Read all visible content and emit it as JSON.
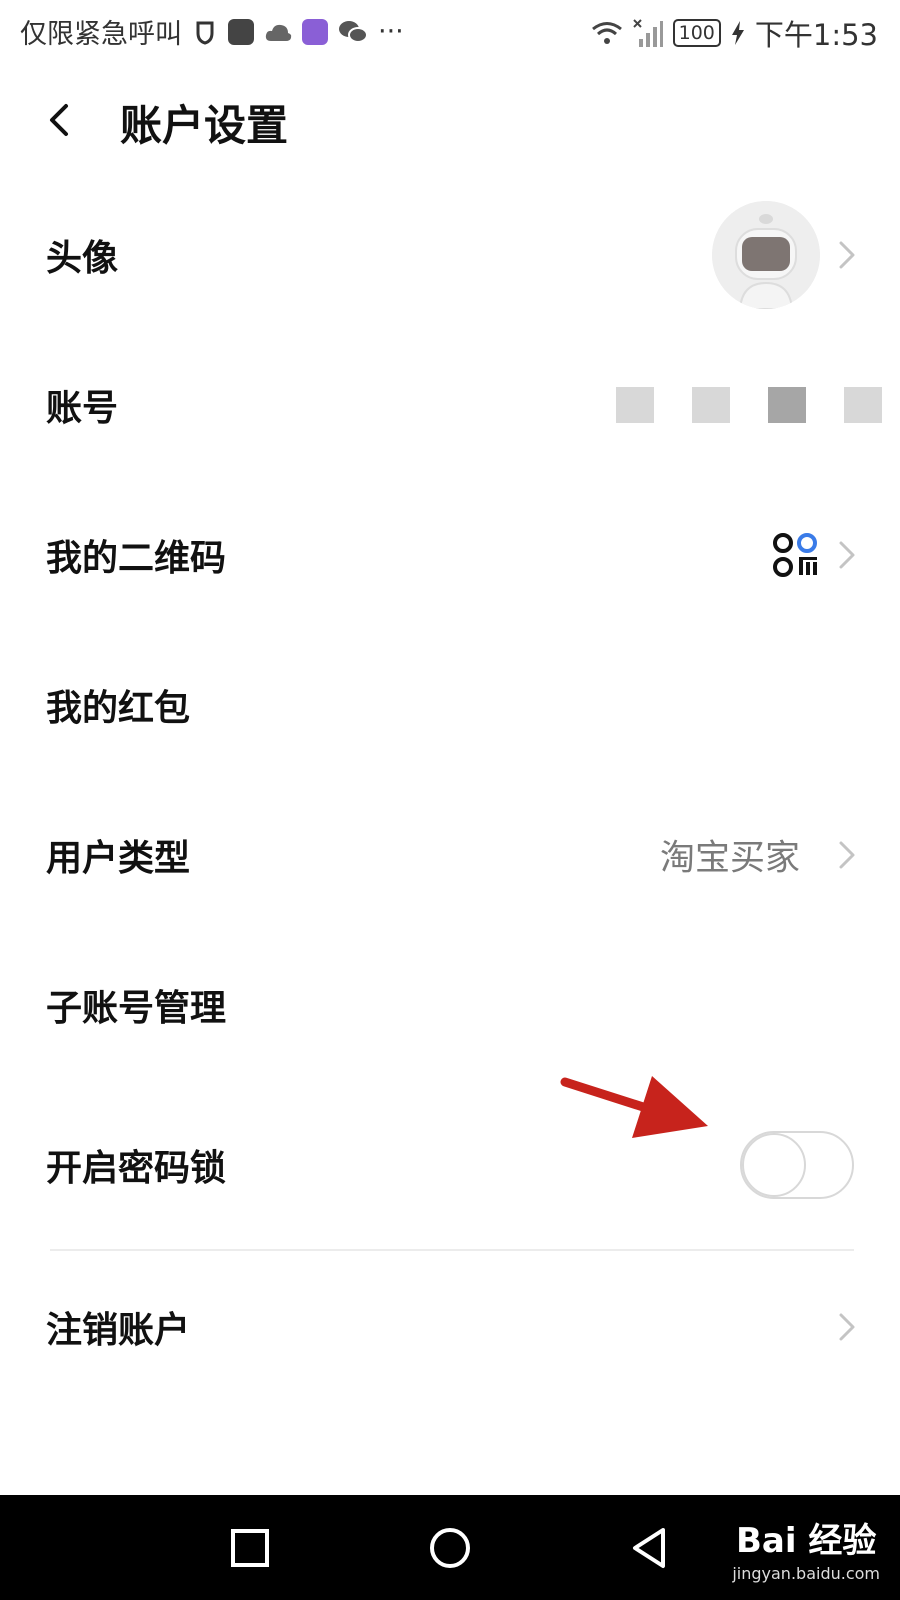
{
  "status_bar": {
    "left_text": "仅限紧急呼叫",
    "more": "···",
    "battery": "100",
    "time": "下午1:53",
    "icons": [
      "shield-icon",
      "huawei-app-icon",
      "cloud-icon",
      "browser-app-icon",
      "wechat-icon",
      "wifi-icon",
      "no-signal-icon",
      "battery-icon",
      "charging-icon"
    ]
  },
  "header": {
    "title": "账户设置",
    "back_icon": "chevron-left-icon"
  },
  "rows": {
    "avatar": {
      "label": "头像"
    },
    "account": {
      "label": "账号"
    },
    "qrcode": {
      "label": "我的二维码"
    },
    "red_packet": {
      "label": "我的红包"
    },
    "user_type": {
      "label": "用户类型",
      "value": "淘宝买家"
    },
    "sub_account": {
      "label": "子账号管理"
    },
    "password_lock": {
      "label": "开启密码锁",
      "enabled": false
    },
    "cancel_account": {
      "label": "注销账户"
    }
  },
  "annotation": {
    "color": "#c7231c"
  },
  "nav_bar": {
    "buttons": [
      "recent-apps-icon",
      "home-icon",
      "back-triangle-icon"
    ]
  },
  "watermark": {
    "brand": "Bai 经验",
    "url": "jingyan.baidu.com"
  }
}
